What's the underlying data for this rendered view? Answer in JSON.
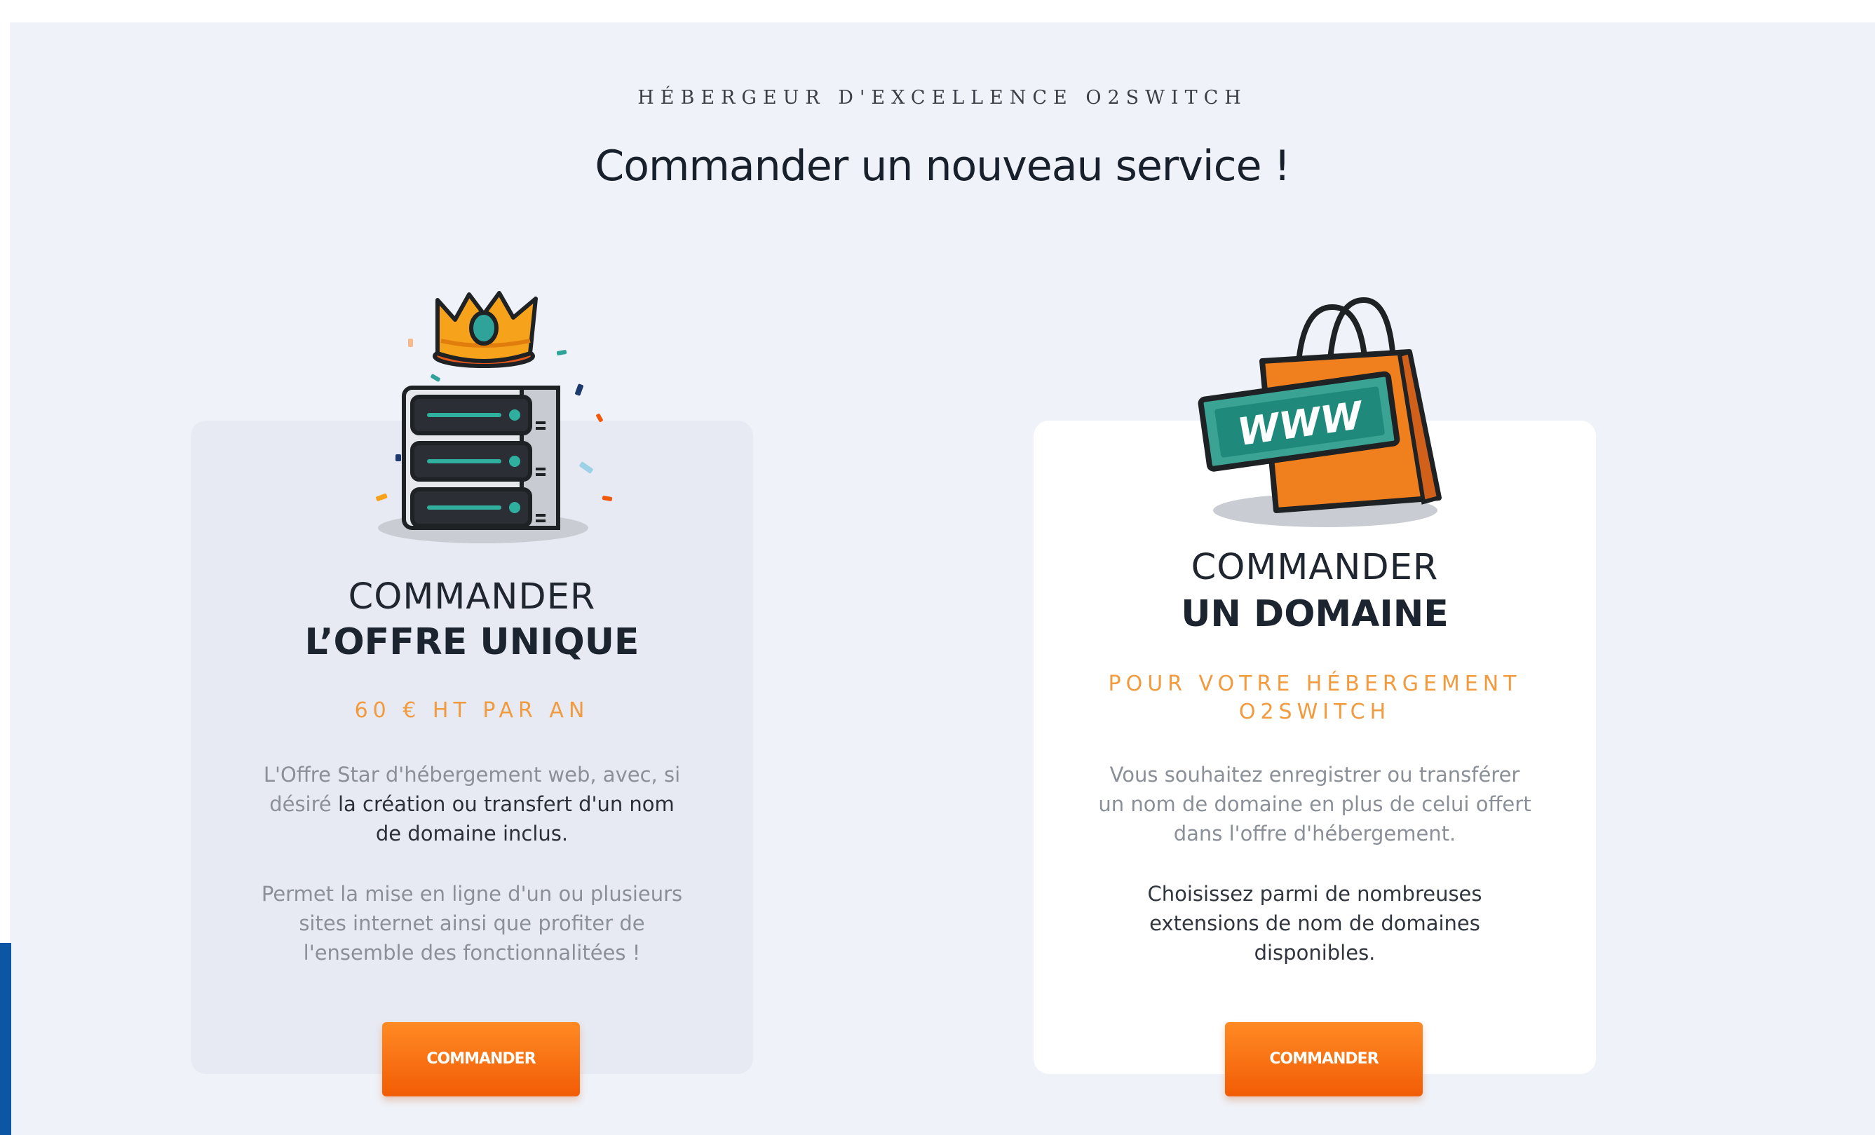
{
  "header": {
    "kicker": "HÉBERGEUR D'EXCELLENCE O2SWITCH",
    "title": "Commander un nouveau service !"
  },
  "cards": [
    {
      "heading_light": "COMMANDER",
      "heading_bold": "L’OFFRE UNIQUE",
      "price": "60 € HT PAR AN",
      "desc_part1": "L'Offre Star d'hébergement web, avec, si désiré ",
      "desc_strong": "la création ou transfert d'un nom de domaine inclus.",
      "desc2": "Permet la mise en ligne d'un ou plusieurs sites internet ainsi que profiter de l'ensemble des fonctionnalitées !",
      "button": "COMMANDER",
      "icon": "server-crown-icon"
    },
    {
      "heading_light": "COMMANDER",
      "heading_bold": "UN DOMAINE",
      "subtitle_line1": "POUR VOTRE HÉBERGEMENT",
      "subtitle_line2": "O2SWITCH",
      "desc1": "Vous souhaitez enregistrer ou transférer un nom de domaine en plus de celui offert dans l'offre d'hébergement.",
      "desc2": "Choisissez parmi de nombreuses extensions de nom de domaines disponibles.",
      "button": "COMMANDER",
      "icon": "shopping-bag-www-icon",
      "bag_label": "WWW"
    }
  ],
  "colors": {
    "accent": "#f2690f",
    "price_text": "#f19a3e",
    "background": "#eff2f8",
    "side_bar": "#0d56a6"
  }
}
